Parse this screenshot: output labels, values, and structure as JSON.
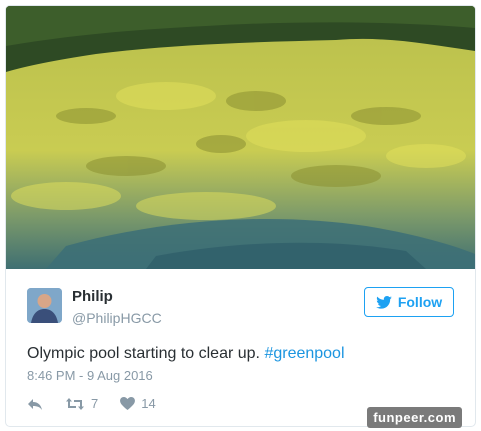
{
  "tweet": {
    "author_name": "Philip",
    "author_handle": "@PhilipHGCC",
    "follow_label": "Follow",
    "text_main": "Olympic pool starting to clear up. ",
    "hashtag": "#greenpool",
    "timestamp": "8:46 PM - 9 Aug 2016",
    "retweet_count": "7",
    "like_count": "14"
  },
  "icons": {
    "reply": "reply-icon",
    "retweet": "retweet-icon",
    "like": "heart-icon",
    "follow_bird": "twitter-bird-icon"
  },
  "colors": {
    "twitter_blue": "#1da1f2",
    "text": "#292f33",
    "muted": "#8899a6"
  },
  "watermark": "funpeer.com"
}
